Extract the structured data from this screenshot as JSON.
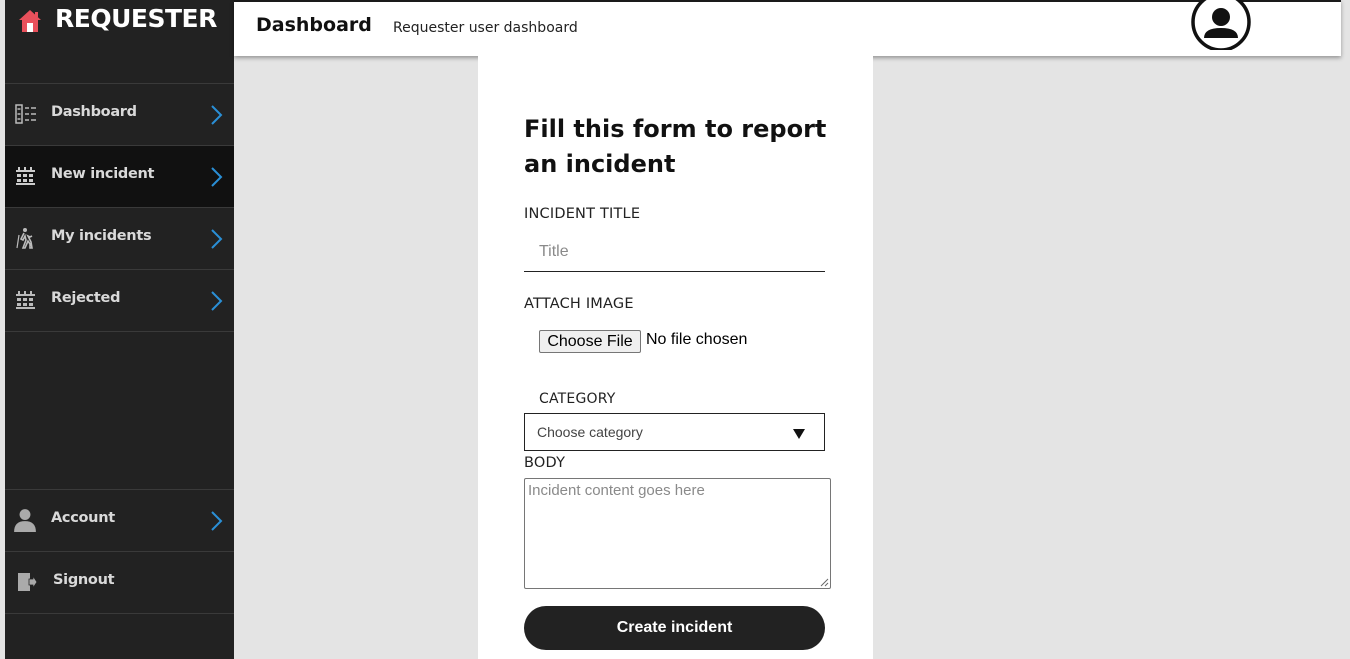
{
  "brand": {
    "name": "REQUESTER",
    "icon": "house-icon",
    "icon_color": "#e8505b"
  },
  "sidebar": {
    "items": [
      {
        "label": "Dashboard",
        "icon": "list-icon",
        "active": false
      },
      {
        "label": "New incident",
        "icon": "calendar-grid-icon",
        "active": true
      },
      {
        "label": "My incidents",
        "icon": "hiker-icon",
        "active": false
      },
      {
        "label": "Rejected",
        "icon": "calendar-grid-icon",
        "active": false
      }
    ],
    "bottom_items": [
      {
        "label": "Account",
        "icon": "user-icon"
      },
      {
        "label": "Signout",
        "icon": "sign-out-icon"
      }
    ],
    "chevron_color": "#2a8fd6"
  },
  "header": {
    "title": "Dashboard",
    "subtitle": "Requester user dashboard",
    "avatar_icon": "user-circle-icon"
  },
  "form": {
    "heading": "Fill this form to report an incident",
    "title_label": "INCIDENT TITLE",
    "title_placeholder": "Title",
    "image_label": "ATTACH IMAGE",
    "file_button": "Choose File",
    "file_status": "No file chosen",
    "category_label": "CATEGORY",
    "category_selected": "Choose category",
    "body_label": "BODY",
    "body_placeholder": "Incident content goes here",
    "submit_label": "Create incident"
  },
  "colors": {
    "sidebar_bg": "#222222",
    "active_item_bg": "#111111",
    "page_bg": "#e4e4e4",
    "button_bg": "#222222"
  }
}
